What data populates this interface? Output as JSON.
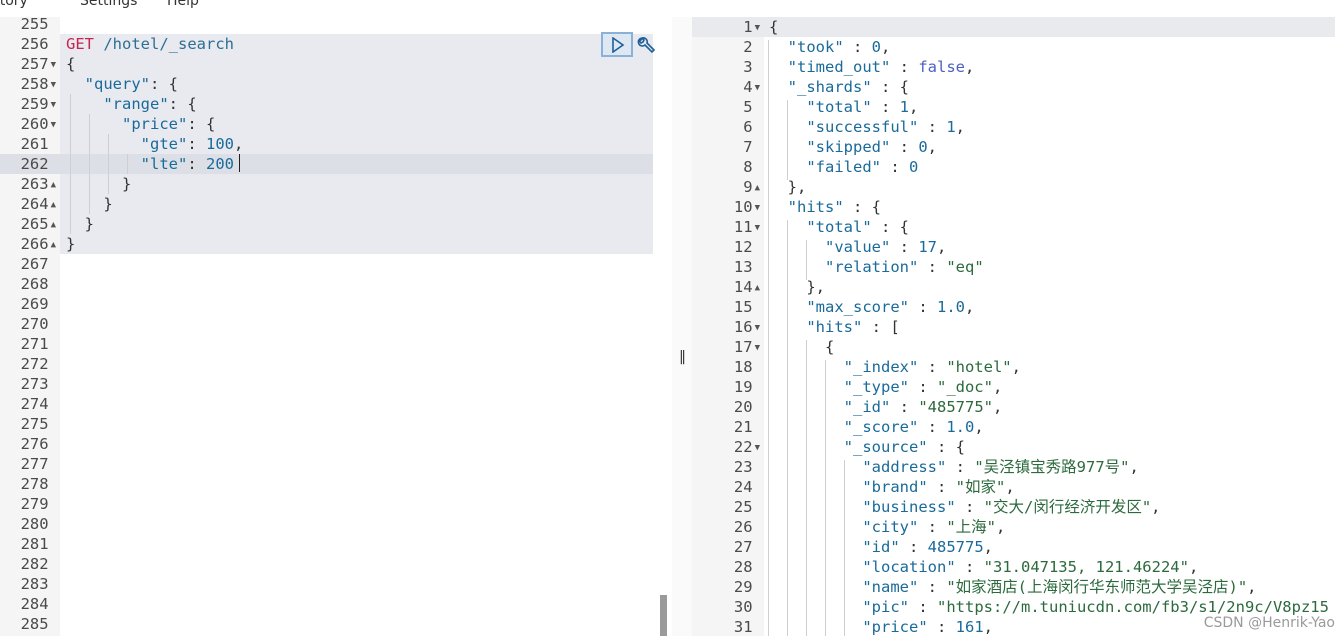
{
  "menu": {
    "items": [
      "History",
      "Settings",
      "Help"
    ]
  },
  "request": {
    "lines": [
      {
        "n": "255",
        "t": []
      },
      {
        "n": "256",
        "t": [
          [
            "m",
            "GET"
          ],
          [
            "p",
            " "
          ],
          [
            "u",
            "/hotel/_search"
          ]
        ]
      },
      {
        "n": "257",
        "f": "down",
        "t": [
          [
            "p",
            "{"
          ]
        ]
      },
      {
        "n": "258",
        "f": "down",
        "t": [
          [
            "p",
            "  "
          ],
          [
            "k",
            "\"query\""
          ],
          [
            "p",
            ": {"
          ]
        ]
      },
      {
        "n": "259",
        "f": "down",
        "t": [
          [
            "p",
            "    "
          ],
          [
            "k",
            "\"range\""
          ],
          [
            "p",
            ": {"
          ]
        ]
      },
      {
        "n": "260",
        "f": "down",
        "t": [
          [
            "p",
            "      "
          ],
          [
            "k",
            "\"price\""
          ],
          [
            "p",
            ": {"
          ]
        ]
      },
      {
        "n": "261",
        "t": [
          [
            "p",
            "        "
          ],
          [
            "k",
            "\"gte\""
          ],
          [
            "p",
            ": "
          ],
          [
            "n",
            "100"
          ],
          [
            "p",
            ","
          ]
        ]
      },
      {
        "n": "262",
        "t": [
          [
            "p",
            "        "
          ],
          [
            "k",
            "\"lte\""
          ],
          [
            "p",
            ": "
          ],
          [
            "n",
            "200"
          ]
        ]
      },
      {
        "n": "263",
        "f": "up",
        "t": [
          [
            "p",
            "      }"
          ]
        ]
      },
      {
        "n": "264",
        "f": "up",
        "t": [
          [
            "p",
            "    }"
          ]
        ]
      },
      {
        "n": "265",
        "f": "up",
        "t": [
          [
            "p",
            "  }"
          ]
        ]
      },
      {
        "n": "266",
        "f": "up",
        "t": [
          [
            "p",
            "}"
          ]
        ]
      },
      {
        "n": "267",
        "t": []
      },
      {
        "n": "268",
        "t": []
      },
      {
        "n": "269",
        "t": []
      },
      {
        "n": "270",
        "t": []
      },
      {
        "n": "271",
        "t": []
      },
      {
        "n": "272",
        "t": []
      },
      {
        "n": "273",
        "t": []
      },
      {
        "n": "274",
        "t": []
      },
      {
        "n": "275",
        "t": []
      },
      {
        "n": "276",
        "t": []
      },
      {
        "n": "277",
        "t": []
      },
      {
        "n": "278",
        "t": []
      },
      {
        "n": "279",
        "t": []
      },
      {
        "n": "280",
        "t": []
      },
      {
        "n": "281",
        "t": []
      },
      {
        "n": "282",
        "t": []
      },
      {
        "n": "283",
        "t": []
      },
      {
        "n": "284",
        "t": []
      },
      {
        "n": "285",
        "t": []
      }
    ]
  },
  "response": {
    "lines": [
      {
        "n": "1",
        "f": "down",
        "t": [
          [
            "p",
            "{"
          ]
        ]
      },
      {
        "n": "2",
        "t": [
          [
            "p",
            "  "
          ],
          [
            "k",
            "\"took\""
          ],
          [
            "p",
            " : "
          ],
          [
            "n",
            "0"
          ],
          [
            "p",
            ","
          ]
        ]
      },
      {
        "n": "3",
        "t": [
          [
            "p",
            "  "
          ],
          [
            "k",
            "\"timed_out\""
          ],
          [
            "p",
            " : "
          ],
          [
            "b",
            "false"
          ],
          [
            "p",
            ","
          ]
        ]
      },
      {
        "n": "4",
        "f": "down",
        "t": [
          [
            "p",
            "  "
          ],
          [
            "k",
            "\"_shards\""
          ],
          [
            "p",
            " : {"
          ]
        ]
      },
      {
        "n": "5",
        "t": [
          [
            "p",
            "    "
          ],
          [
            "k",
            "\"total\""
          ],
          [
            "p",
            " : "
          ],
          [
            "n",
            "1"
          ],
          [
            "p",
            ","
          ]
        ]
      },
      {
        "n": "6",
        "t": [
          [
            "p",
            "    "
          ],
          [
            "k",
            "\"successful\""
          ],
          [
            "p",
            " : "
          ],
          [
            "n",
            "1"
          ],
          [
            "p",
            ","
          ]
        ]
      },
      {
        "n": "7",
        "t": [
          [
            "p",
            "    "
          ],
          [
            "k",
            "\"skipped\""
          ],
          [
            "p",
            " : "
          ],
          [
            "n",
            "0"
          ],
          [
            "p",
            ","
          ]
        ]
      },
      {
        "n": "8",
        "t": [
          [
            "p",
            "    "
          ],
          [
            "k",
            "\"failed\""
          ],
          [
            "p",
            " : "
          ],
          [
            "n",
            "0"
          ]
        ]
      },
      {
        "n": "9",
        "f": "up",
        "t": [
          [
            "p",
            "  },"
          ]
        ]
      },
      {
        "n": "10",
        "f": "down",
        "t": [
          [
            "p",
            "  "
          ],
          [
            "k",
            "\"hits\""
          ],
          [
            "p",
            " : {"
          ]
        ]
      },
      {
        "n": "11",
        "f": "down",
        "t": [
          [
            "p",
            "    "
          ],
          [
            "k",
            "\"total\""
          ],
          [
            "p",
            " : {"
          ]
        ]
      },
      {
        "n": "12",
        "t": [
          [
            "p",
            "      "
          ],
          [
            "k",
            "\"value\""
          ],
          [
            "p",
            " : "
          ],
          [
            "n",
            "17"
          ],
          [
            "p",
            ","
          ]
        ]
      },
      {
        "n": "13",
        "t": [
          [
            "p",
            "      "
          ],
          [
            "k",
            "\"relation\""
          ],
          [
            "p",
            " : "
          ],
          [
            "s",
            "\"eq\""
          ]
        ]
      },
      {
        "n": "14",
        "f": "up",
        "t": [
          [
            "p",
            "    },"
          ]
        ]
      },
      {
        "n": "15",
        "t": [
          [
            "p",
            "    "
          ],
          [
            "k",
            "\"max_score\""
          ],
          [
            "p",
            " : "
          ],
          [
            "n",
            "1.0"
          ],
          [
            "p",
            ","
          ]
        ]
      },
      {
        "n": "16",
        "f": "down",
        "t": [
          [
            "p",
            "    "
          ],
          [
            "k",
            "\"hits\""
          ],
          [
            "p",
            " : ["
          ]
        ]
      },
      {
        "n": "17",
        "f": "down",
        "t": [
          [
            "p",
            "      {"
          ]
        ]
      },
      {
        "n": "18",
        "t": [
          [
            "p",
            "        "
          ],
          [
            "k",
            "\"_index\""
          ],
          [
            "p",
            " : "
          ],
          [
            "s",
            "\"hotel\""
          ],
          [
            "p",
            ","
          ]
        ]
      },
      {
        "n": "19",
        "t": [
          [
            "p",
            "        "
          ],
          [
            "k",
            "\"_type\""
          ],
          [
            "p",
            " : "
          ],
          [
            "s",
            "\"_doc\""
          ],
          [
            "p",
            ","
          ]
        ]
      },
      {
        "n": "20",
        "t": [
          [
            "p",
            "        "
          ],
          [
            "k",
            "\"_id\""
          ],
          [
            "p",
            " : "
          ],
          [
            "s",
            "\"485775\""
          ],
          [
            "p",
            ","
          ]
        ]
      },
      {
        "n": "21",
        "t": [
          [
            "p",
            "        "
          ],
          [
            "k",
            "\"_score\""
          ],
          [
            "p",
            " : "
          ],
          [
            "n",
            "1.0"
          ],
          [
            "p",
            ","
          ]
        ]
      },
      {
        "n": "22",
        "f": "down",
        "t": [
          [
            "p",
            "        "
          ],
          [
            "k",
            "\"_source\""
          ],
          [
            "p",
            " : {"
          ]
        ]
      },
      {
        "n": "23",
        "t": [
          [
            "p",
            "          "
          ],
          [
            "k",
            "\"address\""
          ],
          [
            "p",
            " : "
          ],
          [
            "s",
            "\"吴泾镇宝秀路977号\""
          ],
          [
            "p",
            ","
          ]
        ]
      },
      {
        "n": "24",
        "t": [
          [
            "p",
            "          "
          ],
          [
            "k",
            "\"brand\""
          ],
          [
            "p",
            " : "
          ],
          [
            "s",
            "\"如家\""
          ],
          [
            "p",
            ","
          ]
        ]
      },
      {
        "n": "25",
        "t": [
          [
            "p",
            "          "
          ],
          [
            "k",
            "\"business\""
          ],
          [
            "p",
            " : "
          ],
          [
            "s",
            "\"交大/闵行经济开发区\""
          ],
          [
            "p",
            ","
          ]
        ]
      },
      {
        "n": "26",
        "t": [
          [
            "p",
            "          "
          ],
          [
            "k",
            "\"city\""
          ],
          [
            "p",
            " : "
          ],
          [
            "s",
            "\"上海\""
          ],
          [
            "p",
            ","
          ]
        ]
      },
      {
        "n": "27",
        "t": [
          [
            "p",
            "          "
          ],
          [
            "k",
            "\"id\""
          ],
          [
            "p",
            " : "
          ],
          [
            "n",
            "485775"
          ],
          [
            "p",
            ","
          ]
        ]
      },
      {
        "n": "28",
        "t": [
          [
            "p",
            "          "
          ],
          [
            "k",
            "\"location\""
          ],
          [
            "p",
            " : "
          ],
          [
            "s",
            "\"31.047135, 121.46224\""
          ],
          [
            "p",
            ","
          ]
        ]
      },
      {
        "n": "29",
        "t": [
          [
            "p",
            "          "
          ],
          [
            "k",
            "\"name\""
          ],
          [
            "p",
            " : "
          ],
          [
            "s",
            "\"如家酒店(上海闵行华东师范大学吴泾店)\""
          ],
          [
            "p",
            ","
          ]
        ]
      },
      {
        "n": "30",
        "t": [
          [
            "p",
            "          "
          ],
          [
            "k",
            "\"pic\""
          ],
          [
            "p",
            " : "
          ],
          [
            "s",
            "\"https://m.tuniucdn.com/fb3/s1/2n9c/V8pz15"
          ]
        ]
      },
      {
        "n": "31",
        "t": [
          [
            "p",
            "          "
          ],
          [
            "k",
            "\"price\""
          ],
          [
            "p",
            " : "
          ],
          [
            "n",
            "161"
          ],
          [
            "p",
            ","
          ]
        ]
      }
    ]
  },
  "watermark": "CSDN @Henrik-Yao",
  "splitter_glyph": "‖",
  "colors": {
    "method": "#c7254e",
    "key": "#1a6a9a",
    "string": "#2b6a3c",
    "bool": "#4b5fc7",
    "selection": "#e8eaf0"
  }
}
